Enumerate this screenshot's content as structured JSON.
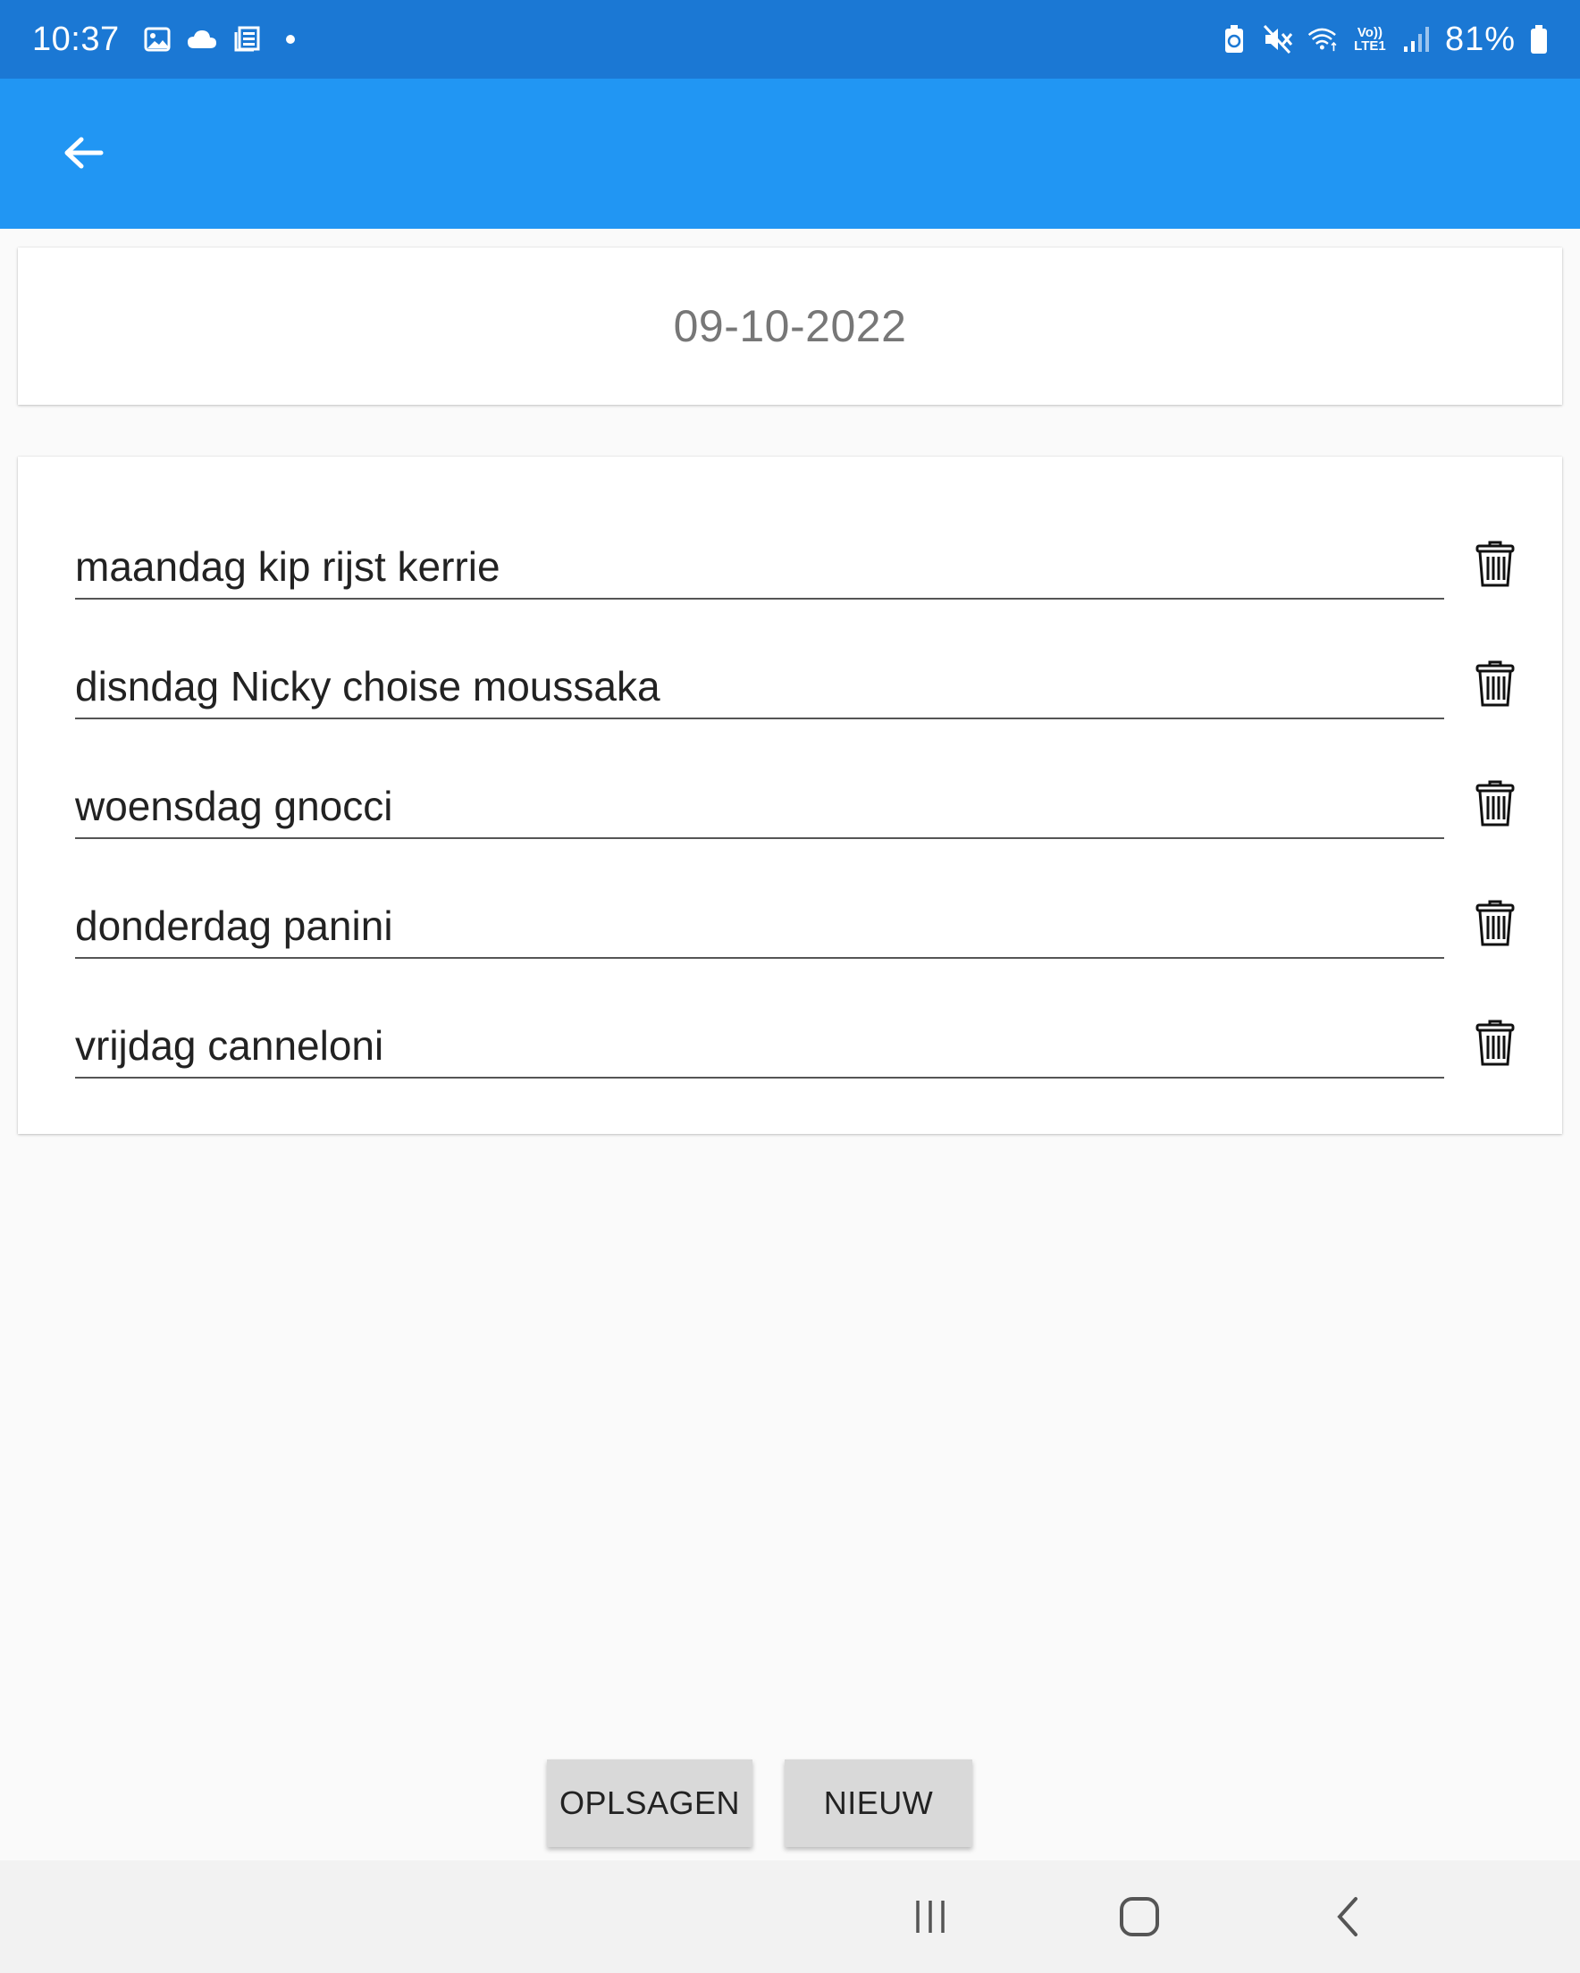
{
  "status_bar": {
    "time": "10:37",
    "left_icons": [
      "gallery-icon",
      "cloud-icon",
      "news-icon",
      "notification-dot"
    ],
    "right_icons": [
      "battery-saver-icon",
      "mute-icon",
      "wifi-icon",
      "volte-icon",
      "signal-icon",
      "battery-icon"
    ],
    "volte_top": "Vo))",
    "volte_bottom": "LTE1",
    "battery_percent": "81%",
    "color": "#1b78d4"
  },
  "app_bar": {
    "back_icon": "arrow-back-icon",
    "color": "#2196f3"
  },
  "date_card": {
    "date": "09-10-2022"
  },
  "meals": [
    {
      "value": "maandag kip rijst kerrie",
      "delete_icon": "trash-icon"
    },
    {
      "value": "disndag Nicky choise moussaka",
      "delete_icon": "trash-icon"
    },
    {
      "value": "woensdag gnocci",
      "delete_icon": "trash-icon"
    },
    {
      "value": "donderdag panini",
      "delete_icon": "trash-icon"
    },
    {
      "value": "vrijdag canneloni",
      "delete_icon": "trash-icon"
    }
  ],
  "actions": {
    "save_label": "OPLSAGEN",
    "new_label": "NIEUW"
  },
  "nav_bar": {
    "icons": [
      "recents-icon",
      "home-icon",
      "back-icon"
    ]
  }
}
